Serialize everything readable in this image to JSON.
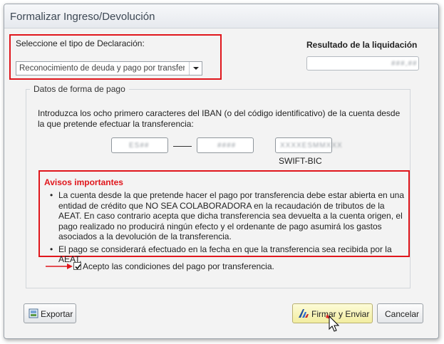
{
  "window": {
    "title": "Formalizar Ingreso/Devolución"
  },
  "declaration": {
    "label": "Seleccione el tipo de Declaración:",
    "selected": "Reconocimiento de deuda y pago por transferencia"
  },
  "result": {
    "label": "Resultado de la liquidación",
    "value": "###,##"
  },
  "payment": {
    "legend": "Datos de forma de pago",
    "intro": "Introduzca los ocho primero caracteres del IBAN (o del código identificativo) de la cuenta desde la que pretende efectuar la transferencia:",
    "iban_part1": "ES##",
    "iban_part2": "####",
    "swift_value": "XXXXESMMXXX",
    "swift_label": "SWIFT-BIC"
  },
  "notices": {
    "title": "Avisos importantes",
    "items": [
      "La cuenta desde la que pretende hacer el pago por transferencia debe estar abierta en una entidad de crédito que NO SEA COLABORADORA en la recaudación de tributos de la AEAT. En caso contrario acepta que dicha transferencia sea devuelta a la cuenta origen, el pago realizado no producirá ningún efecto y el ordenante de pago asumirá los gastos asociados a la devolución de la transferencia.",
      "El pago se considerará efectuado en la fecha en que la transferencia sea recibida por la AEAT."
    ]
  },
  "accept": {
    "label": "Acepto las condiciones del pago por transferencia.",
    "checked": true
  },
  "buttons": {
    "export": "Exportar",
    "sign": "Firmar y Enviar",
    "cancel": "Cancelar"
  },
  "colors": {
    "highlight": "#e0161c",
    "sign_button": "#f2eda0"
  }
}
